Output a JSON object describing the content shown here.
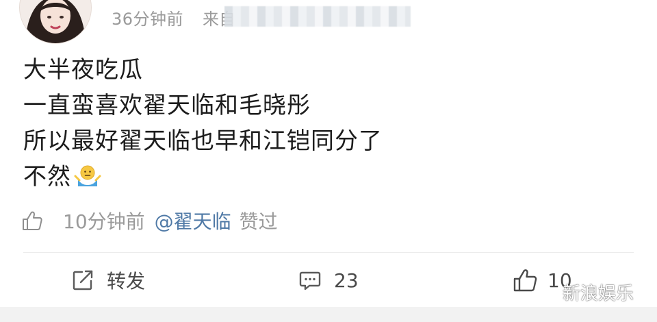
{
  "header": {
    "time": "36分钟前",
    "source_prefix": "来自"
  },
  "post": {
    "lines": [
      "大半夜吃瓜",
      "一直蛮喜欢翟天临和毛晓彤",
      "所以最好翟天临也早和江铠同分了",
      "不然"
    ],
    "emoji": "shrug-emoji"
  },
  "like_notice": {
    "time": "10分钟前",
    "user": "@翟天临",
    "action": "赞过"
  },
  "actions": {
    "repost_label": "转发",
    "comment_count": "23",
    "like_count": "10"
  },
  "watermark": {
    "label": "新浪娱乐"
  },
  "colors": {
    "secondary_text": "#9a9a9a",
    "link_blue": "#4f79a6",
    "body_text": "#1c1c1c"
  }
}
